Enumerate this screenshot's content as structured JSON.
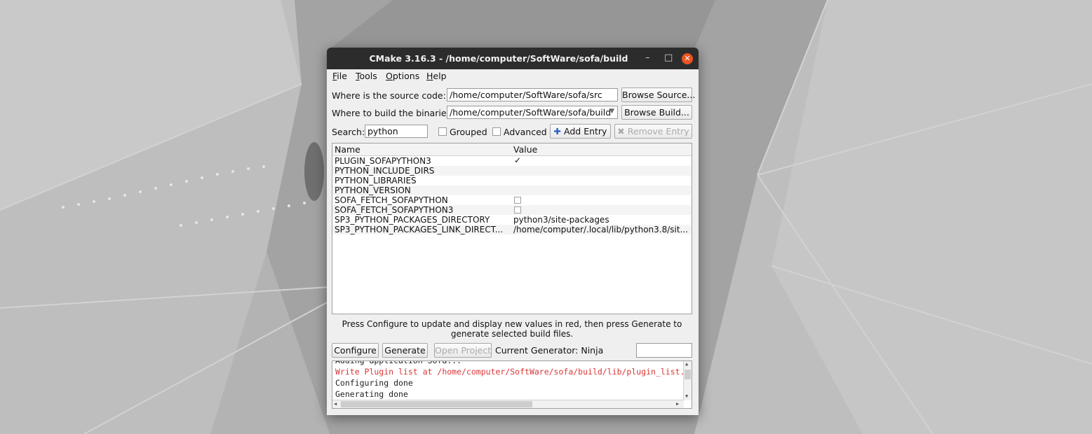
{
  "window": {
    "title": "CMake 3.16.3 - /home/computer/SoftWare/sofa/build",
    "minimize": "–",
    "maximize": "□",
    "close": "✕"
  },
  "menu": [
    {
      "key": "F",
      "rest": "ile"
    },
    {
      "key": "T",
      "rest": "ools"
    },
    {
      "key": "O",
      "rest": "ptions"
    },
    {
      "key": "H",
      "rest": "elp"
    }
  ],
  "paths": {
    "source_label": "Where is the source code:",
    "source_value": "/home/computer/SoftWare/sofa/src",
    "browse_source": "Browse Source...",
    "build_label": "Where to build the binaries:",
    "build_value": "/home/computer/SoftWare/sofa/build",
    "browse_build": "Browse Build..."
  },
  "search": {
    "label": "Search:",
    "value": "python",
    "grouped": "Grouped",
    "advanced": "Advanced",
    "add_entry": "Add Entry",
    "remove_entry": "Remove Entry"
  },
  "table": {
    "columns": [
      "Name",
      "Value"
    ],
    "rows": [
      {
        "name": "PLUGIN_SOFAPYTHON3",
        "type": "check",
        "checked": true,
        "value": ""
      },
      {
        "name": "PYTHON_INCLUDE_DIRS",
        "type": "text",
        "value": ""
      },
      {
        "name": "PYTHON_LIBRARIES",
        "type": "text",
        "value": ""
      },
      {
        "name": "PYTHON_VERSION",
        "type": "text",
        "value": ""
      },
      {
        "name": "SOFA_FETCH_SOFAPYTHON",
        "type": "check",
        "checked": false,
        "value": ""
      },
      {
        "name": "SOFA_FETCH_SOFAPYTHON3",
        "type": "check",
        "checked": false,
        "value": ""
      },
      {
        "name": "SP3_PYTHON_PACKAGES_DIRECTORY",
        "type": "text",
        "value": "python3/site-packages"
      },
      {
        "name": "SP3_PYTHON_PACKAGES_LINK_DIRECT...",
        "type": "text",
        "value": "/home/computer/.local/lib/python3.8/sit..."
      }
    ]
  },
  "hint": "Press Configure to update and display new values in red, then press Generate to generate selected build files.",
  "actions": {
    "configure": "Configure",
    "generate": "Generate",
    "open_project": "Open Project",
    "generator": "Current Generator: Ninja"
  },
  "log": [
    {
      "text": "Adding application Sofa...",
      "color": "#222222"
    },
    {
      "text": "Write Plugin list at /home/computer/SoftWare/sofa/build/lib/plugin_list.conf",
      "color": "#d93636"
    },
    {
      "text": "Configuring done",
      "color": "#222222"
    },
    {
      "text": "Generating done",
      "color": "#222222"
    }
  ],
  "colors": {
    "accent": "#e95420",
    "error": "#d93636"
  }
}
